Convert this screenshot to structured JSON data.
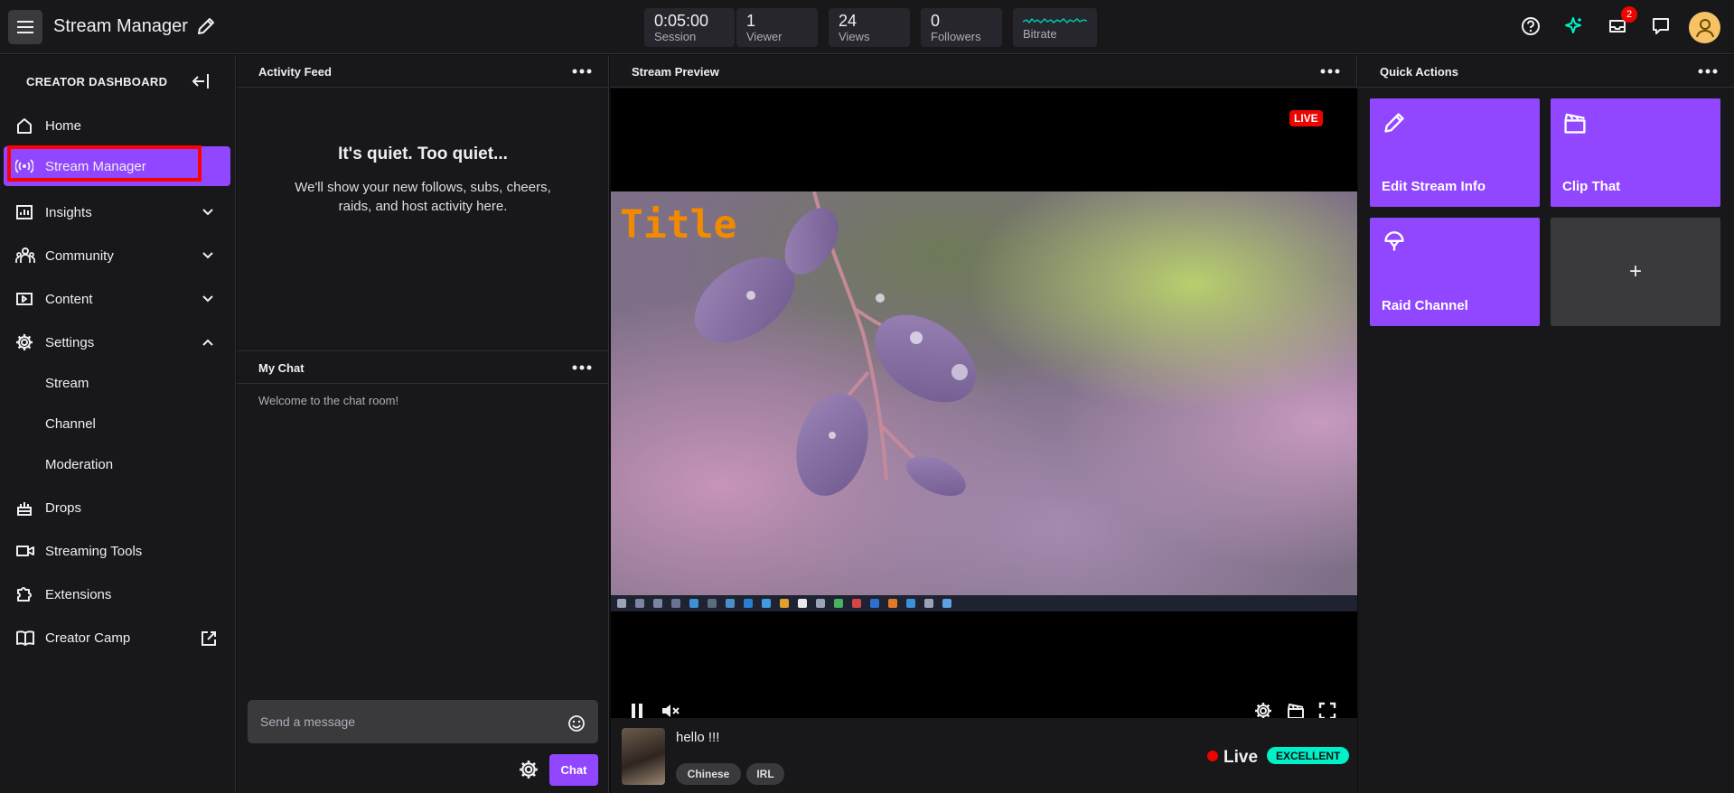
{
  "header": {
    "app_title": "Stream Manager",
    "stats": [
      {
        "value": "0:05:00",
        "label": "Session"
      },
      {
        "value": "1",
        "label": "Viewer"
      },
      {
        "value": "24",
        "label": "Views"
      },
      {
        "value": "0",
        "label": "Followers"
      },
      {
        "value": "",
        "label": "Bitrate"
      }
    ],
    "notification_count": "2",
    "accent": "#9147ff"
  },
  "sidebar": {
    "title": "CREATOR DASHBOARD",
    "items": [
      {
        "label": "Home",
        "icon": "home-icon"
      },
      {
        "label": "Stream Manager",
        "icon": "broadcast-icon",
        "active": true
      },
      {
        "label": "Insights",
        "icon": "chart-icon",
        "expandable": true
      },
      {
        "label": "Community",
        "icon": "community-icon",
        "expandable": true
      },
      {
        "label": "Content",
        "icon": "content-icon",
        "expandable": true
      },
      {
        "label": "Settings",
        "icon": "gear-icon",
        "expanded": true
      },
      {
        "label": "Drops",
        "icon": "drops-icon"
      },
      {
        "label": "Streaming Tools",
        "icon": "camera-icon"
      },
      {
        "label": "Extensions",
        "icon": "puzzle-icon"
      },
      {
        "label": "Creator Camp",
        "icon": "book-icon",
        "external": true
      }
    ],
    "settings_subitems": [
      "Stream",
      "Channel",
      "Moderation"
    ]
  },
  "activity_feed": {
    "title": "Activity Feed",
    "empty_title": "It's quiet. Too quiet...",
    "empty_text": "We'll show your new follows, subs, cheers, raids, and host activity here."
  },
  "chat": {
    "title": "My Chat",
    "welcome": "Welcome to the chat room!",
    "input_placeholder": "Send a message",
    "send_label": "Chat"
  },
  "preview": {
    "title": "Stream Preview",
    "live_badge": "LIVE",
    "overlay_title": "Title",
    "stream_title": "hello !!!",
    "tags": [
      "Chinese",
      "IRL"
    ],
    "status": "Live",
    "health": "EXCELLENT"
  },
  "quick_actions": {
    "title": "Quick Actions",
    "actions": [
      {
        "label": "Edit Stream Info",
        "icon": "pencil-icon"
      },
      {
        "label": "Clip That",
        "icon": "clapper-icon"
      },
      {
        "label": "Raid Channel",
        "icon": "raid-icon"
      }
    ],
    "add_label": "+"
  }
}
